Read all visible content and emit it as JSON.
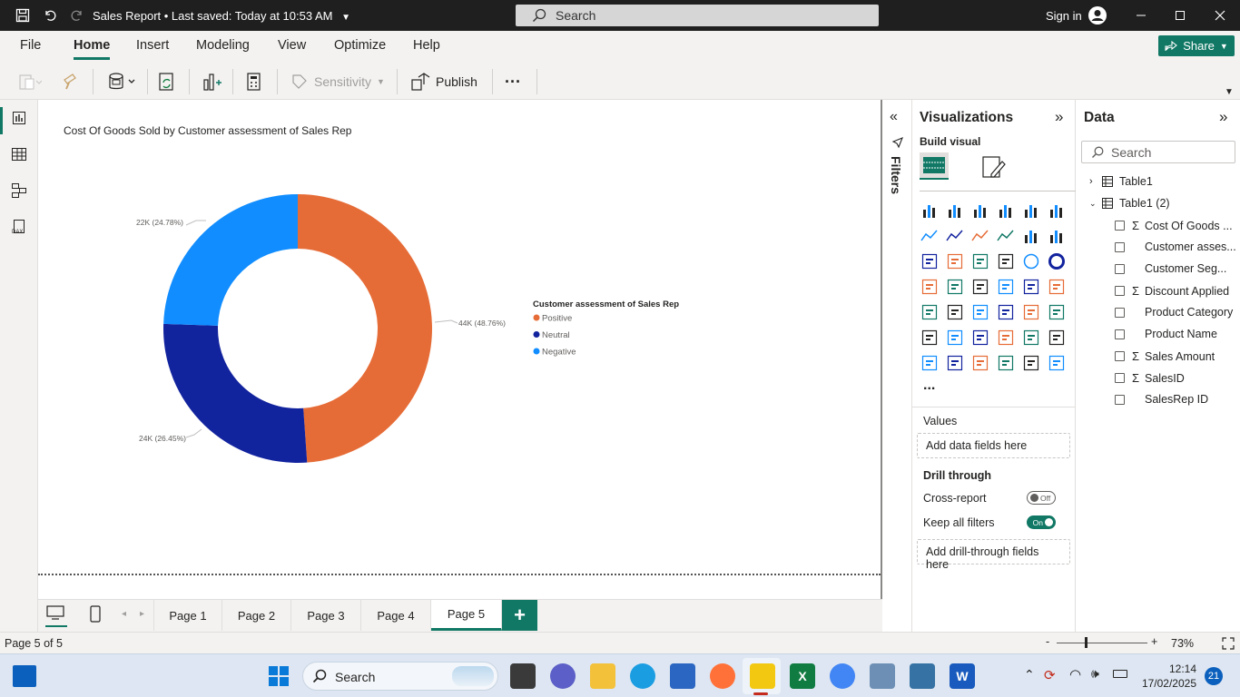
{
  "titlebar": {
    "doc_title": "Sales Report • Last saved: Today at 10:53 AM",
    "search_placeholder": "Search",
    "signin": "Sign in"
  },
  "menu": {
    "file": "File",
    "home": "Home",
    "insert": "Insert",
    "modeling": "Modeling",
    "view": "View",
    "optimize": "Optimize",
    "help": "Help",
    "share": "Share"
  },
  "ribbon": {
    "sensitivity": "Sensitivity",
    "publish": "Publish",
    "more": "···"
  },
  "chart": {
    "title": "Cost Of Goods Sold by Customer assessment of Sales Rep",
    "legend_title": "Customer assessment of Sales Rep",
    "label_positive": "44K (48.76%)",
    "label_neutral": "24K (26.45%)",
    "label_negative": "22K (24.78%)"
  },
  "chart_data": {
    "type": "pie",
    "title": "Cost Of Goods Sold by Customer assessment of Sales Rep",
    "legend_title": "Customer assessment of Sales Rep",
    "legend_position": "right",
    "donut": true,
    "categories": [
      "Positive",
      "Neutral",
      "Negative"
    ],
    "values": [
      44000,
      24000,
      22000
    ],
    "percent": [
      48.76,
      26.45,
      24.78
    ],
    "colors": [
      "#E66C37",
      "#12239E",
      "#118DFF"
    ]
  },
  "filters": {
    "label": "Filters"
  },
  "viz": {
    "title": "Visualizations",
    "build_visual": "Build visual",
    "more": "...",
    "values": "Values",
    "add_data": "Add data fields here",
    "drill_through": "Drill through",
    "cross_report": "Cross-report",
    "cross_report_state": "Off",
    "keep_filters": "Keep all filters",
    "keep_filters_state": "On",
    "add_drill": "Add drill-through fields here"
  },
  "data_pane": {
    "title": "Data",
    "search_placeholder": "Search",
    "tables": [
      "Table1",
      "Table1 (2)"
    ],
    "fields": [
      {
        "name": "Cost Of Goods ...",
        "sigma": "Σ"
      },
      {
        "name": "Customer asses...",
        "sigma": ""
      },
      {
        "name": "Customer Seg...",
        "sigma": ""
      },
      {
        "name": "Discount Applied",
        "sigma": "Σ"
      },
      {
        "name": "Product Category",
        "sigma": ""
      },
      {
        "name": "Product Name",
        "sigma": ""
      },
      {
        "name": "Sales Amount",
        "sigma": "Σ"
      },
      {
        "name": "SalesID",
        "sigma": "Σ"
      },
      {
        "name": "SalesRep ID",
        "sigma": ""
      }
    ]
  },
  "pages": [
    "Page 1",
    "Page 2",
    "Page 3",
    "Page 4",
    "Page 5"
  ],
  "status": {
    "page_info": "Page 5 of 5",
    "zoom": "73%"
  },
  "taskbar": {
    "search": "Search",
    "time": "12:14",
    "date": "17/02/2025",
    "badge": "21"
  }
}
